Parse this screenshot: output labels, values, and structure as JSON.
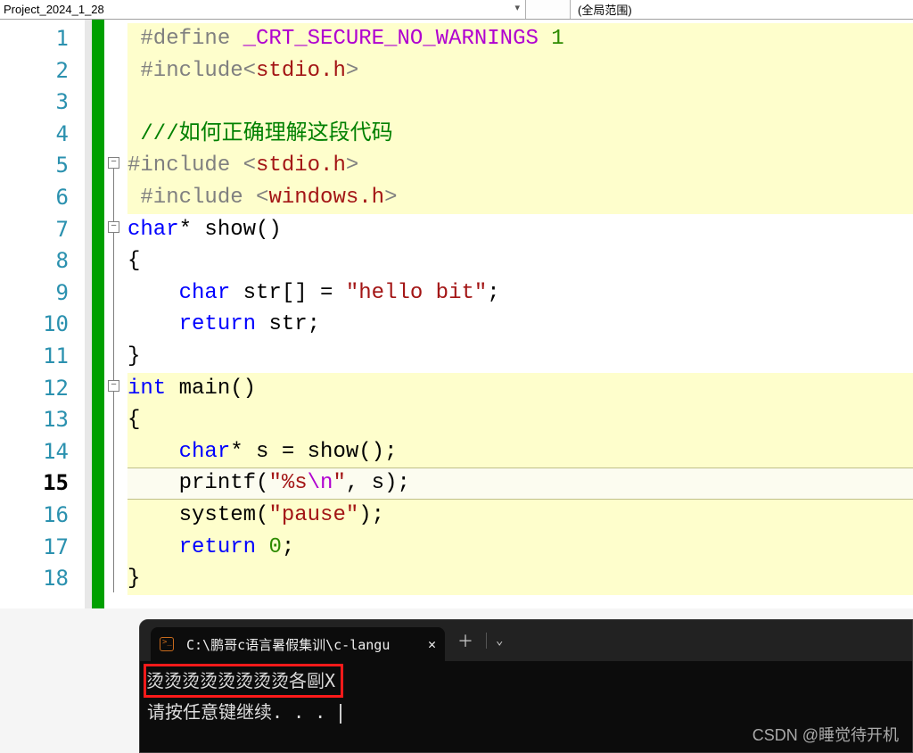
{
  "toolbar": {
    "project": "Project_2024_1_28",
    "scope": "(全局范围)"
  },
  "gutter": {
    "lines": [
      "1",
      "2",
      "3",
      "4",
      "5",
      "6",
      "7",
      "8",
      "9",
      "10",
      "11",
      "12",
      "13",
      "14",
      "15",
      "16",
      "17",
      "18"
    ],
    "current": 15
  },
  "code": {
    "l1": {
      "pre": "#define ",
      "macro": "_CRT_SECURE_NO_WARNINGS",
      "sp": " ",
      "num": "1"
    },
    "l2": {
      "pre": "#include",
      "br1": "<",
      "hdr": "stdio.h",
      "br2": ">"
    },
    "l3": "",
    "l4": {
      "c": "///如何正确理解这段代码"
    },
    "l5": {
      "pre": "#include ",
      "br1": "<",
      "hdr": "stdio.h",
      "br2": ">"
    },
    "l6": {
      "pre": "#include ",
      "br1": "<",
      "hdr": "windows.h",
      "br2": ">"
    },
    "l7": {
      "kw": "char",
      "star": "* ",
      "fn": "show",
      "par": "()"
    },
    "l8": {
      "brace": "{"
    },
    "l9": {
      "kw": "char",
      "sp": " ",
      "id": "str",
      "br": "[] = ",
      "q1": "\"",
      "s": "hello bit",
      "q2": "\"",
      "semi": ";"
    },
    "l10": {
      "kw": "return",
      "sp": " ",
      "id": "str",
      "semi": ";"
    },
    "l11": {
      "brace": "}"
    },
    "l12": {
      "kw": "int",
      "sp": " ",
      "fn": "main",
      "par": "()"
    },
    "l13": {
      "brace": "{"
    },
    "l14": {
      "kw": "char",
      "star": "* ",
      "id": "s",
      "eq": " = ",
      "fn": "show",
      "par": "();"
    },
    "l15": {
      "fn": "printf",
      "op": "(",
      "q1": "\"",
      "fmt": "%s",
      "esc": "\\n",
      "q2": "\"",
      "rest": ", s);"
    },
    "l16": {
      "fn": "system",
      "op": "(",
      "q1": "\"",
      "s": "pause",
      "q2": "\"",
      "rest": ");"
    },
    "l17": {
      "kw": "return",
      "sp": " ",
      "num": "0",
      "semi": ";"
    },
    "l18": {
      "brace": "}"
    }
  },
  "terminal": {
    "tab_title": "C:\\鹏哥c语言暑假集训\\c-langu",
    "output1": "烫烫烫烫烫烫烫烫各剾X",
    "output2": "请按任意键继续. . . "
  },
  "watermark": "CSDN @睡觉待开机"
}
